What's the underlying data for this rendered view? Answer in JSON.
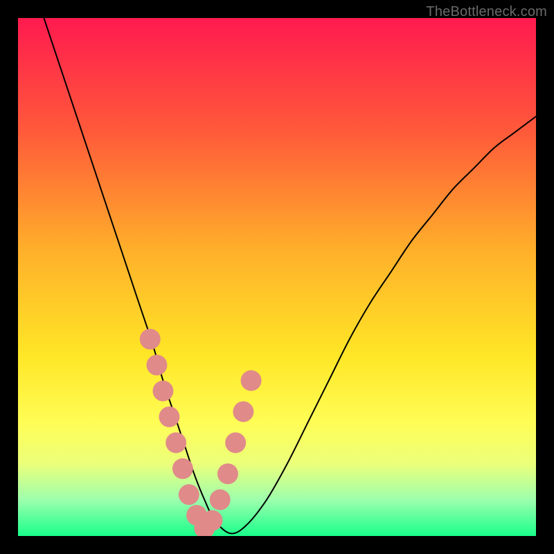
{
  "watermark": "TheBottleneck.com",
  "chart_data": {
    "type": "line",
    "title": "",
    "xlabel": "",
    "ylabel": "",
    "xlim": [
      0,
      100
    ],
    "ylim": [
      0,
      100
    ],
    "gradient_stops": [
      {
        "offset": 0,
        "color": "#ff1a4f"
      },
      {
        "offset": 22,
        "color": "#ff5a3a"
      },
      {
        "offset": 45,
        "color": "#ffb02a"
      },
      {
        "offset": 65,
        "color": "#ffe626"
      },
      {
        "offset": 78,
        "color": "#fffd55"
      },
      {
        "offset": 86,
        "color": "#ecff7a"
      },
      {
        "offset": 93,
        "color": "#9dffad"
      },
      {
        "offset": 100,
        "color": "#19ff8a"
      }
    ],
    "series": [
      {
        "name": "bottleneck-curve",
        "x": [
          5,
          8,
          11,
          14,
          17,
          20,
          23,
          26,
          28,
          30,
          32,
          34,
          36,
          38,
          41,
          44,
          48,
          52,
          56,
          60,
          64,
          68,
          72,
          76,
          80,
          84,
          88,
          92,
          96,
          100
        ],
        "y": [
          100,
          91,
          82,
          73,
          64,
          55,
          46,
          37,
          30,
          24,
          18,
          12,
          7,
          3,
          0.5,
          2,
          7,
          14,
          22,
          30,
          38,
          45,
          51,
          57,
          62,
          67,
          71,
          75,
          78,
          81
        ]
      }
    ],
    "markers": {
      "name": "highlight-dots",
      "color": "#e08a8a",
      "radius": 2.0,
      "x": [
        25.5,
        26.8,
        28.0,
        29.2,
        30.5,
        31.8,
        33.0,
        34.5,
        36.0,
        37.5,
        39.0,
        40.5,
        42.0,
        43.5,
        45.0
      ],
      "y": [
        38,
        33,
        28,
        23,
        18,
        13,
        8,
        4,
        1.5,
        3,
        7,
        12,
        18,
        24,
        30
      ]
    }
  }
}
